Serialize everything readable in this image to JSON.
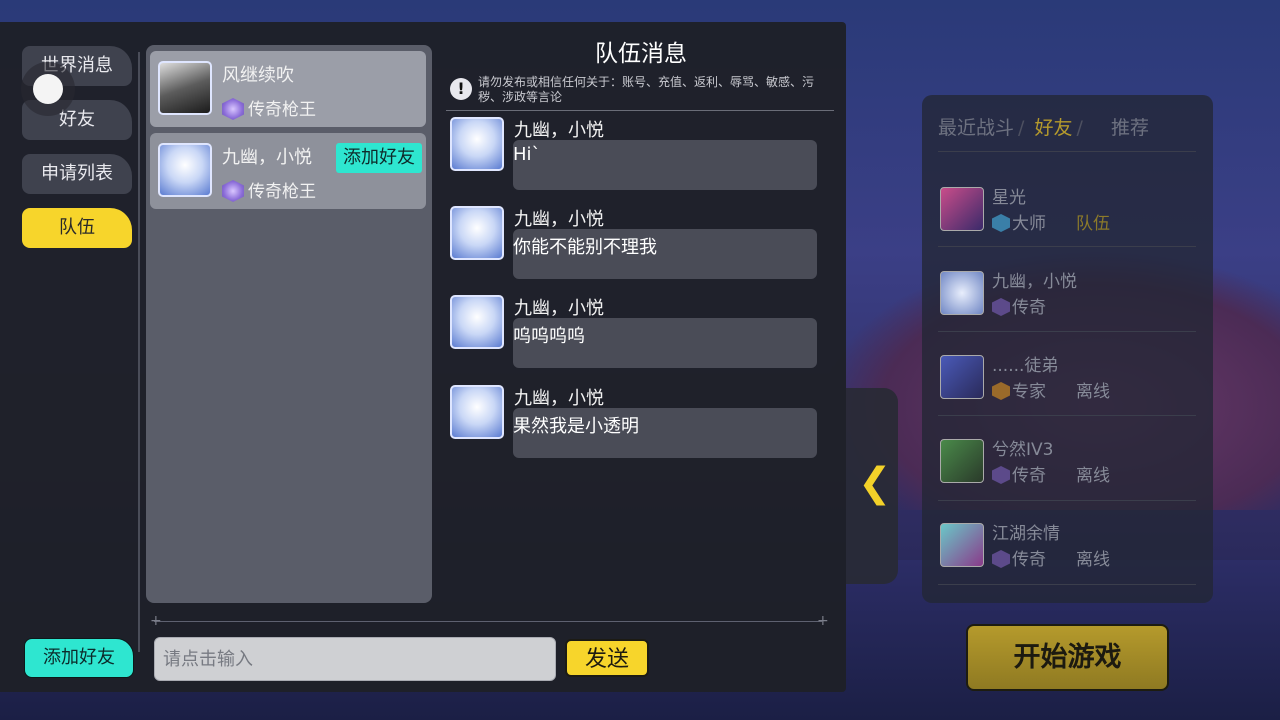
{
  "sidebar": {
    "tabs": [
      {
        "label": "世界消息",
        "active": false
      },
      {
        "label": "好友",
        "active": false
      },
      {
        "label": "申请列表",
        "active": false
      },
      {
        "label": "队伍",
        "active": true
      }
    ],
    "add_friend_label": "添加好友"
  },
  "members": [
    {
      "name": "风继续吹",
      "rank": "传奇枪王",
      "avatar": "dark-hooded-character"
    },
    {
      "name": "九幽，小悦",
      "rank": "传奇枪王",
      "avatar": "blue-hair-anime-girl",
      "add_label": "添加好友"
    }
  ],
  "chat": {
    "title": "队伍消息",
    "notice": "请勿发布或相信任何关于：账号、充值、返利、辱骂、敏感、污秽、涉政等言论",
    "messages": [
      {
        "sender": "九幽，小悦",
        "text": "Hi`"
      },
      {
        "sender": "九幽，小悦",
        "text": "你能不能别不理我"
      },
      {
        "sender": "九幽，小悦",
        "text": "呜呜呜呜"
      },
      {
        "sender": "九幽，小悦",
        "text": "果然我是小透明"
      }
    ],
    "input_placeholder": "请点击输入",
    "send_label": "发送"
  },
  "right_panel": {
    "tabs": [
      {
        "label": "最近战斗",
        "active": false
      },
      {
        "label": "好友",
        "active": true
      },
      {
        "label": "推荐",
        "active": false
      }
    ],
    "friends": [
      {
        "name": "星光",
        "rank": "大师",
        "status": "队伍"
      },
      {
        "name": "九幽，小悦",
        "rank": "传奇",
        "status": ""
      },
      {
        "name": "......徒弟",
        "rank": "专家",
        "status": "离线"
      },
      {
        "name": "兮然IV3",
        "rank": "传奇",
        "status": "离线"
      },
      {
        "name": "江湖余情",
        "rank": "传奇",
        "status": "离线"
      }
    ],
    "start_game_label": "开始游戏"
  },
  "colors": {
    "accent_yellow": "#f7d52b",
    "accent_cyan": "#2ee6d0",
    "panel_dark": "#1e2028"
  }
}
